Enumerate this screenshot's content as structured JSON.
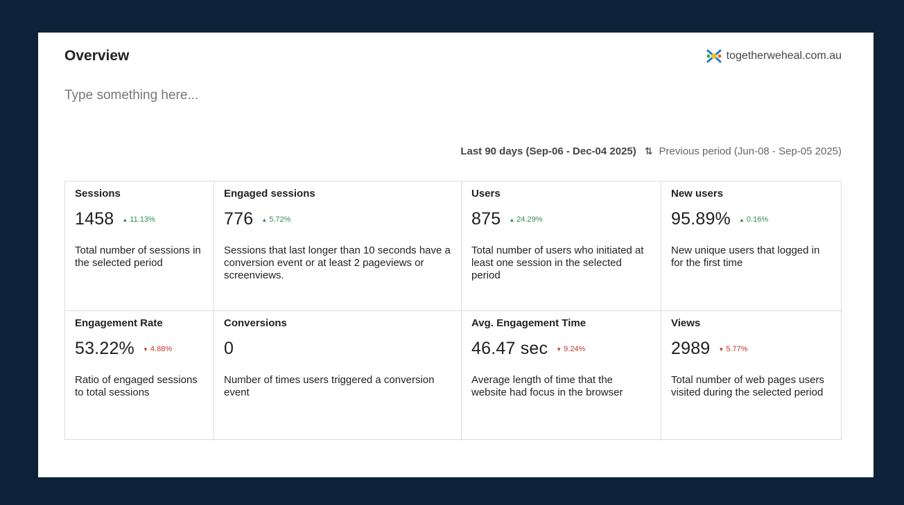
{
  "header": {
    "title": "Overview",
    "site": "togetherweheal.com.au"
  },
  "note": "Type something here...",
  "period": {
    "current": "Last 90 days (Sep-06 - Dec-04 2025)",
    "previous": "Previous period (Jun-08 - Sep-05 2025)"
  },
  "colors": {
    "background": "#0d2238",
    "up": "#2e8b57",
    "down": "#c0392b"
  },
  "metrics": [
    {
      "label": "Sessions",
      "value": "1458",
      "delta": "11.13%",
      "direction": "up",
      "description": "Total number of sessions in the selected period"
    },
    {
      "label": "Engaged sessions",
      "value": "776",
      "delta": "5.72%",
      "direction": "up",
      "description": "Sessions that last longer than 10 seconds have a conversion event or at least 2 pageviews or screenviews."
    },
    {
      "label": "Users",
      "value": "875",
      "delta": "24.29%",
      "direction": "up",
      "description": "Total number of users who initiated at least one session in the selected period"
    },
    {
      "label": "New users",
      "value": "95.89%",
      "delta": "0.16%",
      "direction": "up",
      "description": "New unique users that logged in for the first time"
    },
    {
      "label": "Engagement Rate",
      "value": "53.22%",
      "delta": "4.88%",
      "direction": "down",
      "description": "Ratio of engaged sessions to total sessions"
    },
    {
      "label": "Conversions",
      "value": "0",
      "delta": "",
      "direction": "none",
      "description": "Number of times users triggered a conversion event"
    },
    {
      "label": "Avg. Engagement Time",
      "value": "46.47 sec",
      "delta": "9.24%",
      "direction": "down",
      "description": "Average length of time that the website had focus in the browser"
    },
    {
      "label": "Views",
      "value": "2989",
      "delta": "5.77%",
      "direction": "down",
      "description": "Total number of web pages users visited during the selected period"
    }
  ]
}
